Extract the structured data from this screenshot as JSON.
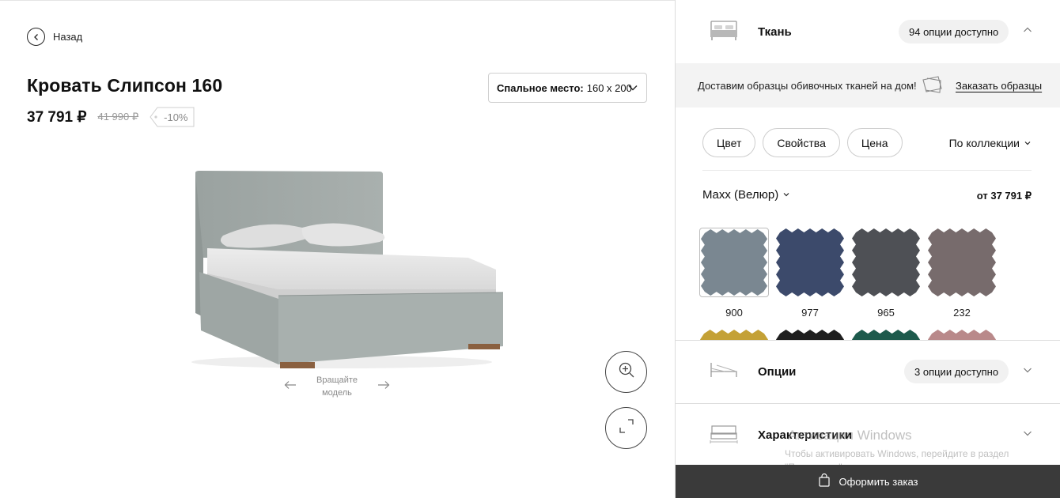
{
  "nav": {
    "back_label": "Назад"
  },
  "product": {
    "title": "Кровать Слипсон 160",
    "price": "37 791 ₽",
    "old_price": "41 990 ₽",
    "discount": "-10%"
  },
  "size_select": {
    "label": "Спальное место:",
    "value": "160 х 200"
  },
  "rotate_hint": {
    "line1": "Вращайте",
    "line2": "модель"
  },
  "panel": {
    "fabric": {
      "title": "Ткань",
      "badge": "94 опции доступно",
      "icon": "bed-icon",
      "samples_message": "Доставим образцы обивочных тканей на дом!",
      "samples_link": "Заказать образцы",
      "filters": [
        "Цвет",
        "Свойства",
        "Цена"
      ],
      "sort_label": "По коллекции",
      "collection": "Maxx (Велюр)",
      "collection_price": "от 37 791 ₽",
      "swatches": [
        {
          "code": "900",
          "color": "#7a8791",
          "selected": true
        },
        {
          "code": "977",
          "color": "#3c4a6b",
          "selected": false
        },
        {
          "code": "965",
          "color": "#4e5055",
          "selected": false
        },
        {
          "code": "232",
          "color": "#776b6c",
          "selected": false
        }
      ],
      "swatches_row2_colors": [
        "#c4a136",
        "#1f1f1f",
        "#1d5a4c",
        "#b9898a"
      ]
    },
    "options": {
      "title": "Опции",
      "badge": "3 опции доступно",
      "icon": "bed-frame-icon"
    },
    "specs": {
      "title": "Характеристики",
      "icon": "bed-dimensions-icon"
    },
    "order_label": "Оформить заказ"
  },
  "watermark": {
    "title": "Активация Windows",
    "text": "Чтобы активировать Windows, перейдите в раздел \"Параметры\"."
  }
}
